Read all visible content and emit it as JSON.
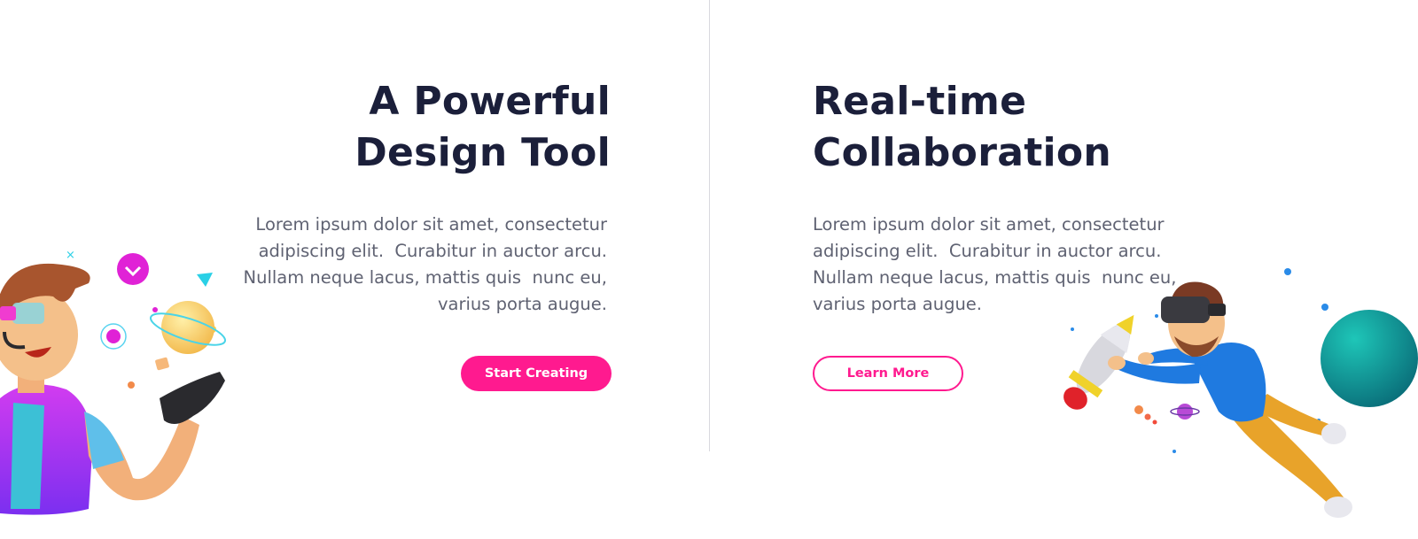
{
  "left": {
    "title_lines": [
      "A Powerful",
      "Design Tool"
    ],
    "description_lines": [
      "Lorem ipsum dolor sit amet, consectetur",
      "adipiscing elit.  Curabitur in auctor arcu.",
      "Nullam neque lacus, mattis quis  nunc eu,",
      "varius porta augue."
    ],
    "button_label": "Start Creating"
  },
  "right": {
    "title_lines": [
      "Real-time",
      "Collaboration"
    ],
    "description_lines": [
      "Lorem ipsum dolor sit amet, consectetur",
      "adipiscing elit.  Curabitur in auctor arcu.",
      "Nullam neque lacus, mattis quis  nunc eu,",
      "varius porta augue."
    ],
    "button_label": "Learn More"
  },
  "colors": {
    "accent": "#ff1a8f",
    "heading": "#1b1f3a",
    "body_text": "#5f6272",
    "divider": "#d8d8de"
  },
  "illustrations": {
    "left": "3d-designer-character-with-ar-glasses",
    "right": "3d-man-with-vr-headset-and-rocket"
  }
}
